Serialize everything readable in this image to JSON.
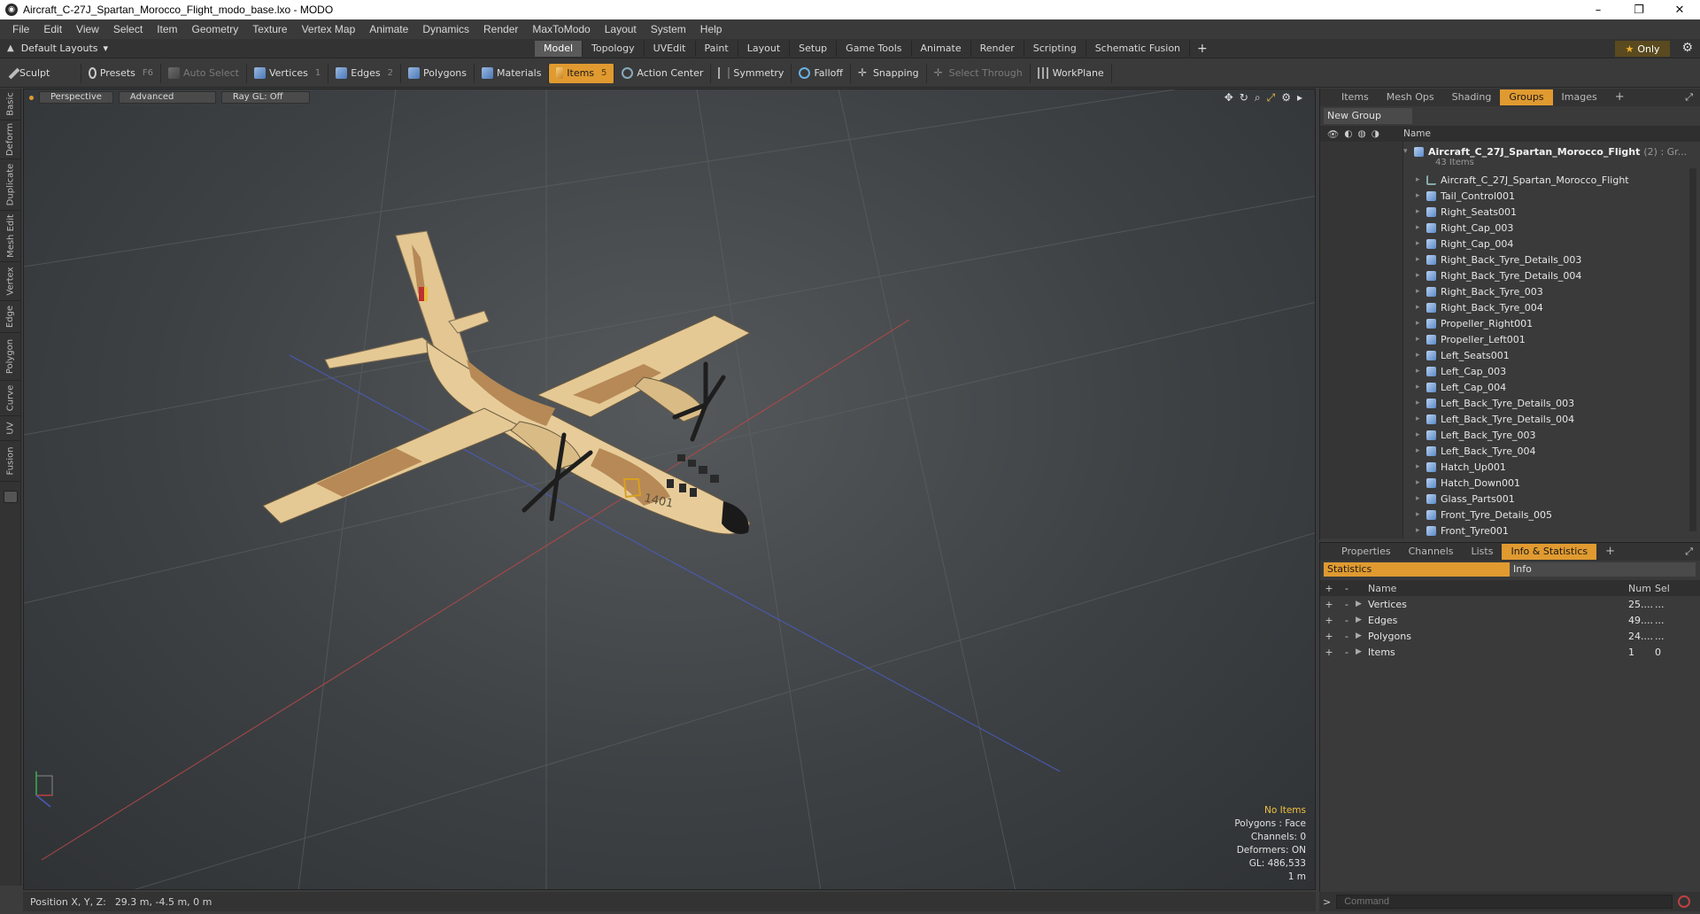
{
  "window": {
    "title": "Aircraft_C-27J_Spartan_Morocco_Flight_modo_base.lxo - MODO",
    "controls": [
      "–",
      "❐",
      "✕"
    ]
  },
  "menu": [
    "File",
    "Edit",
    "View",
    "Select",
    "Item",
    "Geometry",
    "Texture",
    "Vertex Map",
    "Animate",
    "Dynamics",
    "Render",
    "MaxToModo",
    "Layout",
    "System",
    "Help"
  ],
  "layoutbar": {
    "layouts_label": "Default Layouts",
    "tabs": [
      "Model",
      "Topology",
      "UVEdit",
      "Paint",
      "Layout",
      "Setup",
      "Game Tools",
      "Animate",
      "Render",
      "Scripting",
      "Schematic Fusion"
    ],
    "active_tab": "Model",
    "only_label": "Only"
  },
  "toolbar": {
    "sculpt": "Sculpt",
    "presets": "Presets",
    "presets_key": "F6",
    "auto_select": "Auto Select",
    "vertices": "Vertices",
    "vertices_key": "1",
    "edges": "Edges",
    "edges_key": "2",
    "polygons": "Polygons",
    "materials": "Materials",
    "items": "Items",
    "items_key": "5",
    "action_center": "Action Center",
    "symmetry": "Symmetry",
    "falloff": "Falloff",
    "snapping": "Snapping",
    "select_through": "Select Through",
    "workplane": "WorkPlane"
  },
  "vtabs": [
    "Basic",
    "Deform",
    "Duplicate",
    "Mesh Edit",
    "Vertex",
    "Edge",
    "Polygon",
    "Curve",
    "UV",
    "Fusion"
  ],
  "viewport": {
    "view": "Perspective",
    "shading": "Advanced",
    "raygl": "Ray GL: Off",
    "aircraft_number": "1401",
    "info": {
      "selection": "No Items",
      "polygons": "Polygons : Face",
      "channels": "Channels: 0",
      "deformers": "Deformers: ON",
      "gl": "GL: 486,533",
      "scale": "1 m"
    }
  },
  "statusbar": {
    "label": "Position X, Y, Z:",
    "value": "29.3 m, -4.5 m, 0 m"
  },
  "items_panel": {
    "tabs": [
      "Items",
      "Mesh Ops",
      "Shading",
      "Groups",
      "Images"
    ],
    "active_tab": "Groups",
    "new_group": "New Group",
    "name_header": "Name",
    "root": {
      "name": "Aircraft_C_27J_Spartan_Morocco_Flight",
      "count": "(2) : Gr...",
      "sub": "43 Items"
    },
    "items": [
      "Aircraft_C_27J_Spartan_Morocco_Flight",
      "Tail_Control001",
      "Right_Seats001",
      "Right_Cap_003",
      "Right_Cap_004",
      "Right_Back_Tyre_Details_003",
      "Right_Back_Tyre_Details_004",
      "Right_Back_Tyre_003",
      "Right_Back_Tyre_004",
      "Propeller_Right001",
      "Propeller_Left001",
      "Left_Seats001",
      "Left_Cap_003",
      "Left_Cap_004",
      "Left_Back_Tyre_Details_003",
      "Left_Back_Tyre_Details_004",
      "Left_Back_Tyre_003",
      "Left_Back_Tyre_004",
      "Hatch_Up001",
      "Hatch_Down001",
      "Glass_Parts001",
      "Front_Tyre_Details_005",
      "Front_Tyre001"
    ]
  },
  "stats_panel": {
    "tabs": [
      "Properties",
      "Channels",
      "Lists",
      "Info & Statistics"
    ],
    "active_tab": "Info & Statistics",
    "subtabs": [
      "Statistics",
      "Info"
    ],
    "headers": {
      "name": "Name",
      "num": "Num",
      "sel": "Sel"
    },
    "rows": [
      {
        "name": "Vertices",
        "num": "25....",
        "sel": "..."
      },
      {
        "name": "Edges",
        "num": "49....",
        "sel": "..."
      },
      {
        "name": "Polygons",
        "num": "24....",
        "sel": "..."
      },
      {
        "name": "Items",
        "num": "1",
        "sel": "0"
      }
    ]
  },
  "command": {
    "prompt": ">",
    "placeholder": "Command"
  }
}
